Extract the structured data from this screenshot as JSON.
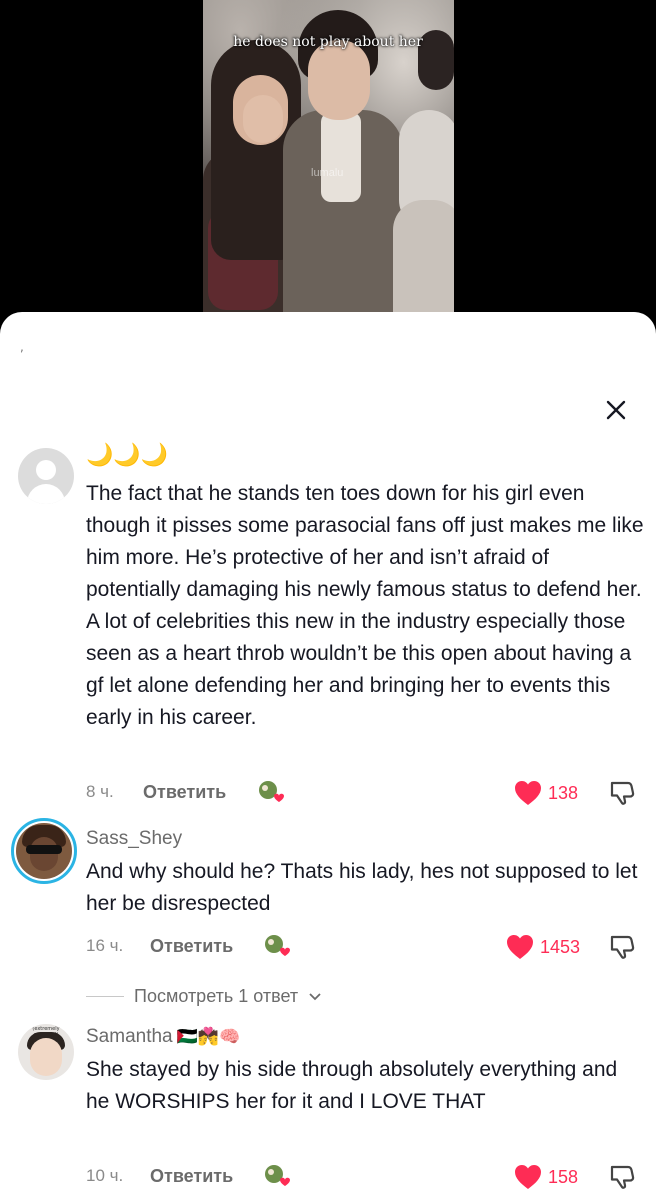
{
  "video": {
    "caption": "he does not play about her",
    "watermark": "lumalu"
  },
  "close_label": "×",
  "comments": [
    {
      "username": "🌙🌙🌙",
      "text": "The fact that he stands ten toes down for his girl even though it pisses some parasocial fans off just makes me like him more. He’s protective of her and isn’t afraid of potentially damaging his newly famous status to defend her. A lot of celebrities this new in the industry especially those seen as a heart throb wouldn’t be this open about having a gf let alone defending her and bringing her to events this early in his career.",
      "time": "8 ч.",
      "reply_label": "Ответить",
      "likes": "138"
    },
    {
      "username": "Sass_Shey",
      "text": "And why should he? Thats his lady, hes not supposed to let her be disrespected",
      "time": "16 ч.",
      "reply_label": "Ответить",
      "likes": "1453",
      "view_replies": "Посмотреть 1 ответ"
    },
    {
      "username": "Samantha",
      "username_emoji": "🇵🇸💏🧠",
      "avatar_caption": "(extremely confused)",
      "text": "She stayed by his side through absolutely everything and he WORSHIPS her for it and I LOVE THAT",
      "time": "10 ч.",
      "reply_label": "Ответить",
      "likes": "158"
    }
  ],
  "colors": {
    "like": "#fe2c55",
    "story_ring": "#2bb4e4",
    "text": "#161823",
    "muted": "#8a8a8a"
  }
}
